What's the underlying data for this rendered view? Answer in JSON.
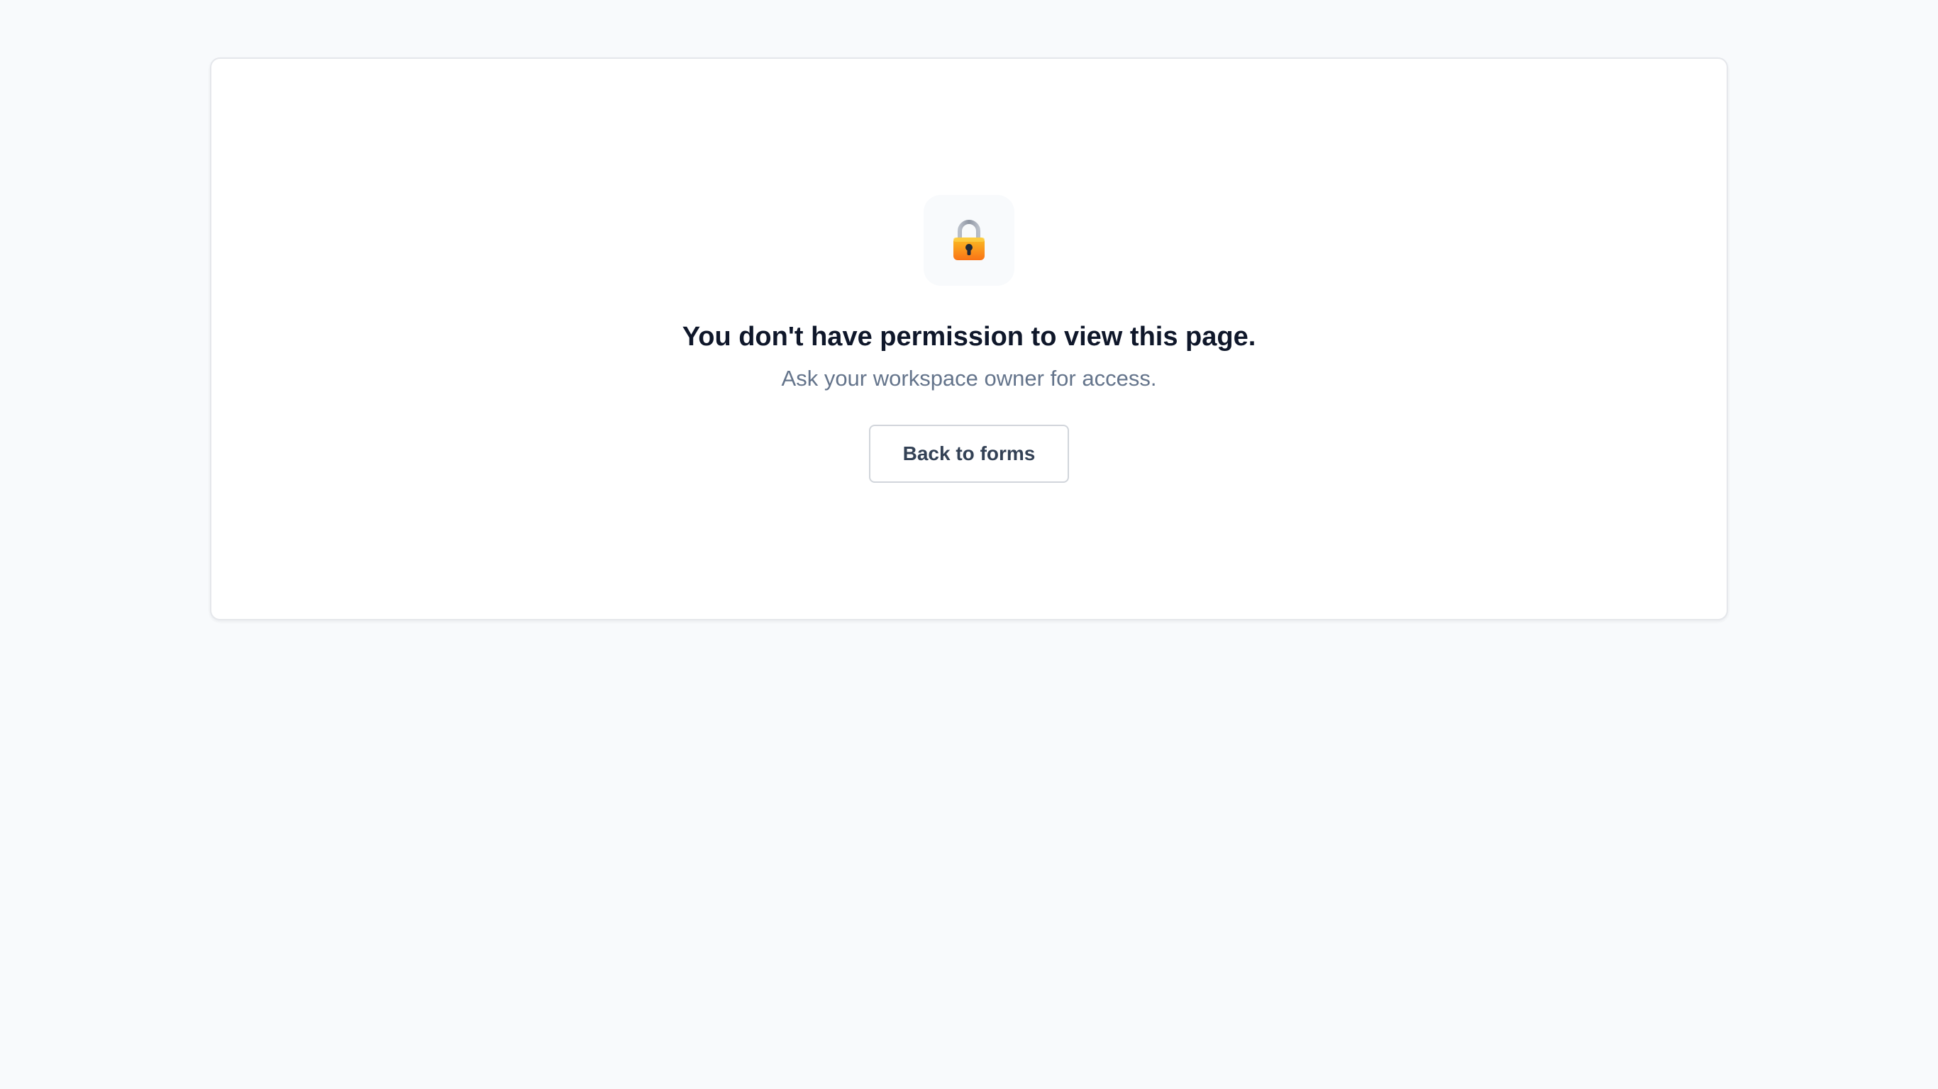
{
  "message": {
    "icon": "lock-icon",
    "title": "You don't have permission to view this page.",
    "subtitle": "Ask your workspace owner for access."
  },
  "actions": {
    "back_label": "Back to forms"
  },
  "colors": {
    "page_background": "#f8fafc",
    "card_background": "#ffffff",
    "title": "#0f172a",
    "subtitle": "#64748b",
    "button_text": "#334155",
    "lock_body": "#f59e0b",
    "lock_shackle": "#9ca3af"
  }
}
